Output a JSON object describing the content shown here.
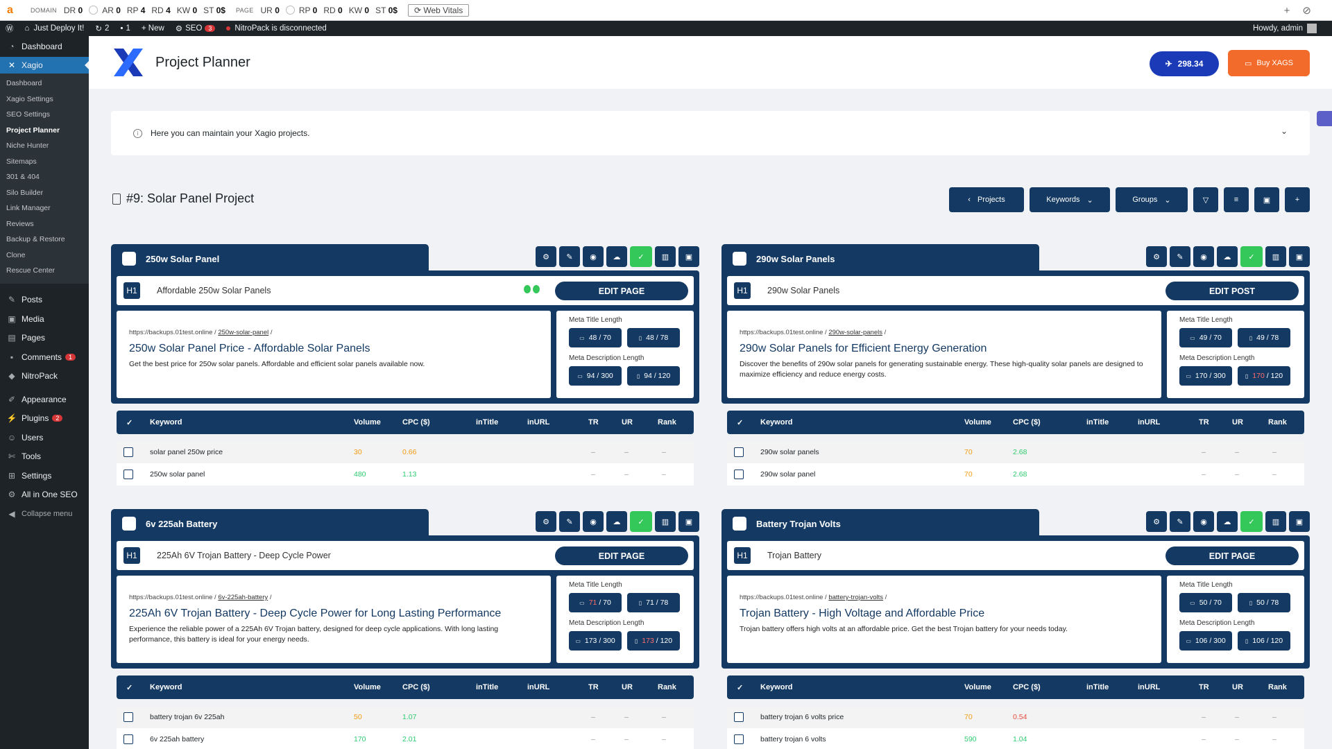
{
  "ext": {
    "domain_label": "DOMAIN",
    "dr": "DR",
    "dr_v": "0",
    "ar": "AR",
    "ar_v": "0",
    "rp": "RP",
    "rp_v": "4",
    "rd": "RD",
    "rd_v": "4",
    "kw": "KW",
    "kw_v": "0",
    "st": "ST",
    "st_v": "0$",
    "page_label": "PAGE",
    "ur": "UR",
    "ur_v": "0",
    "prp": "RP",
    "prp_v": "0",
    "prd": "RD",
    "prd_v": "0",
    "pkw": "KW",
    "pkw_v": "0",
    "pst": "ST",
    "pst_v": "0$",
    "web_vitals": "Web Vitals"
  },
  "adminbar": {
    "site": "Just Deploy It!",
    "updates": "2",
    "comments": "1",
    "new": "New",
    "seo": "SEO",
    "seo_badge": "3",
    "nitro": "NitroPack is disconnected",
    "howdy": "Howdy, admin"
  },
  "sidebar": {
    "dashboard": "Dashboard",
    "xagio": "Xagio",
    "sub": [
      "Dashboard",
      "Xagio Settings",
      "SEO Settings",
      "Project Planner",
      "Niche Hunter",
      "Sitemaps",
      "301 & 404",
      "Silo Builder",
      "Link Manager",
      "Reviews",
      "Backup & Restore",
      "Clone",
      "Rescue Center"
    ],
    "posts": "Posts",
    "media": "Media",
    "pages": "Pages",
    "comments": "Comments",
    "comments_badge": "1",
    "nitropack": "NitroPack",
    "appearance": "Appearance",
    "plugins": "Plugins",
    "plugins_badge": "2",
    "users": "Users",
    "tools": "Tools",
    "settings": "Settings",
    "aioseo": "All in One SEO",
    "collapse": "Collapse menu"
  },
  "header": {
    "title": "Project Planner",
    "xags": "298.34",
    "buy": "Buy XAGS"
  },
  "info": {
    "text": "Here you can maintain your Xagio projects."
  },
  "project": {
    "title": "#9: Solar Panel Project",
    "projects_btn": "Projects",
    "keywords_btn": "Keywords",
    "groups_btn": "Groups"
  },
  "columns": {
    "keyword": "Keyword",
    "volume": "Volume",
    "cpc": "CPC ($)",
    "intitle": "inTitle",
    "inurl": "inURL",
    "tr": "TR",
    "ur": "UR",
    "rank": "Rank"
  },
  "meta_labels": {
    "title": "Meta Title Length",
    "desc": "Meta Description Length"
  },
  "groups": [
    {
      "name": "250w Solar Panel",
      "h1": "Affordable 250w Solar Panels",
      "edit": "EDIT PAGE",
      "url_base": "https://backups.01test.online /",
      "url_slug": "250w-solar-panel",
      "url_end": "/",
      "seo_title": "250w Solar Panel Price - Affordable Solar Panels",
      "seo_desc": "Get the best price for 250w solar panels. Affordable and efficient solar panels available now.",
      "title_d": "48",
      "title_d_max": "/ 70",
      "title_m": "48",
      "title_m_max": "/ 78",
      "desc_d": "94",
      "desc_d_max": "/ 300",
      "desc_m": "94",
      "desc_m_max": "/ 120",
      "keywords": [
        {
          "kw": "solar panel 250w price",
          "vol": "30",
          "cpc": "0.66",
          "tr": "–",
          "ur": "–",
          "rank": "–"
        },
        {
          "kw": "250w solar panel",
          "vol": "480",
          "cpc": "1.13",
          "tr": "–",
          "ur": "–",
          "rank": "–"
        }
      ]
    },
    {
      "name": "290w Solar Panels",
      "h1": "290w Solar Panels",
      "edit": "EDIT POST",
      "url_base": "https://backups.01test.online /",
      "url_slug": "290w-solar-panels",
      "url_end": "/",
      "seo_title": "290w Solar Panels for Efficient Energy Generation",
      "seo_desc": "Discover the benefits of 290w solar panels for generating sustainable energy. These high-quality solar panels are designed to maximize efficiency and reduce energy costs.",
      "title_d": "49",
      "title_d_max": "/ 70",
      "title_m": "49",
      "title_m_max": "/ 78",
      "desc_d": "170",
      "desc_d_max": "/ 300",
      "desc_m": "170",
      "desc_m_max": "/ 120",
      "keywords": [
        {
          "kw": "290w solar panels",
          "vol": "70",
          "cpc": "2.68",
          "tr": "–",
          "ur": "–",
          "rank": "–"
        },
        {
          "kw": "290w solar panel",
          "vol": "70",
          "cpc": "2.68",
          "tr": "–",
          "ur": "–",
          "rank": "–"
        }
      ]
    },
    {
      "name": "6v 225ah Battery",
      "h1": "225Ah 6V Trojan Battery - Deep Cycle Power",
      "edit": "EDIT PAGE",
      "url_base": "https://backups.01test.online /",
      "url_slug": "6v-225ah-battery",
      "url_end": "/",
      "seo_title": "225Ah 6V Trojan Battery - Deep Cycle Power for Long Lasting Performance",
      "seo_desc": "Experience the reliable power of a 225Ah 6V Trojan battery, designed for deep cycle applications. With long lasting performance, this battery is ideal for your energy needs.",
      "title_d": "71",
      "title_d_max": "/ 70",
      "title_m": "71",
      "title_m_max": "/ 78",
      "desc_d": "173",
      "desc_d_max": "/ 300",
      "desc_m": "173",
      "desc_m_max": "/ 120",
      "keywords": [
        {
          "kw": "battery trojan 6v 225ah",
          "vol": "50",
          "cpc": "1.07",
          "tr": "–",
          "ur": "–",
          "rank": "–"
        },
        {
          "kw": "6v 225ah battery",
          "vol": "170",
          "cpc": "2.01",
          "tr": "–",
          "ur": "–",
          "rank": "–"
        }
      ]
    },
    {
      "name": "Battery Trojan Volts",
      "h1": "Trojan Battery",
      "edit": "EDIT PAGE",
      "url_base": "https://backups.01test.online /",
      "url_slug": "battery-trojan-volts",
      "url_end": "/",
      "seo_title": "Trojan Battery - High Voltage and Affordable Price",
      "seo_desc": "Trojan battery offers high volts at an affordable price. Get the best Trojan battery for your needs today.",
      "title_d": "50",
      "title_d_max": "/ 70",
      "title_m": "50",
      "title_m_max": "/ 78",
      "desc_d": "106",
      "desc_d_max": "/ 300",
      "desc_m": "106",
      "desc_m_max": "/ 120",
      "keywords": [
        {
          "kw": "battery trojan 6 volts price",
          "vol": "70",
          "cpc": "0.54",
          "tr": "–",
          "ur": "–",
          "rank": "–"
        },
        {
          "kw": "battery trojan 6 volts",
          "vol": "590",
          "cpc": "1.04",
          "tr": "–",
          "ur": "–",
          "rank": "–"
        }
      ]
    }
  ]
}
